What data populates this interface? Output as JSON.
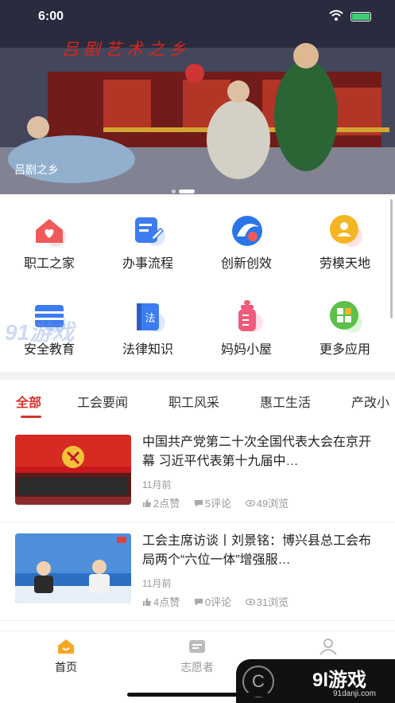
{
  "status_bar": {
    "time": "6:00"
  },
  "banner": {
    "title": "吕剧艺术之乡",
    "caption": "吕剧之乡",
    "slide_count": 2,
    "active_slide": 2
  },
  "grid": {
    "items": [
      {
        "label": "职工之家",
        "icon": "home-heart-icon",
        "color": "#f15a5a"
      },
      {
        "label": "办事流程",
        "icon": "document-edit-icon",
        "color": "#3d7cf0"
      },
      {
        "label": "创新创效",
        "icon": "innovation-swirl-icon",
        "color": "#2a76e8"
      },
      {
        "label": "劳模天地",
        "icon": "person-badge-icon",
        "color": "#f5b623"
      },
      {
        "label": "安全教育",
        "icon": "safety-board-icon",
        "color": "#3d7cf0"
      },
      {
        "label": "法律知识",
        "icon": "law-book-icon",
        "color": "#3d7cf0"
      },
      {
        "label": "妈妈小屋",
        "icon": "baby-bottle-icon",
        "color": "#f15a7a"
      },
      {
        "label": "更多应用",
        "icon": "apps-grid-icon",
        "color": "#5cc04a"
      }
    ]
  },
  "tabs": [
    {
      "label": "全部",
      "active": true
    },
    {
      "label": "工会要闻",
      "active": false
    },
    {
      "label": "职工风采",
      "active": false
    },
    {
      "label": "惠工生活",
      "active": false
    },
    {
      "label": "产改小",
      "active": false
    }
  ],
  "news": [
    {
      "title": "中国共产党第二十次全国代表大会在京开幕 习近平代表第十九届中…",
      "time": "11月前",
      "likes": "2点赞",
      "comments": "5评论",
      "views": "49浏览"
    },
    {
      "title": "工会主席访谈丨刘景铭：博兴县总工会布局两个“六位一体”增强服…",
      "time": "11月前",
      "likes": "4点赞",
      "comments": "0评论",
      "views": "31浏览"
    }
  ],
  "bottom_nav": [
    {
      "label": "首页",
      "icon": "home-icon",
      "active": true
    },
    {
      "label": "志愿者",
      "icon": "volunteer-icon",
      "active": false
    },
    {
      "label": "",
      "icon": "profile-icon",
      "active": false
    }
  ],
  "watermark": {
    "left_text": "91游戏",
    "right_big": "9l游戏",
    "right_small": "91danji.com"
  },
  "colors": {
    "accent": "#d7322b",
    "divider": "#f3f3f3"
  }
}
